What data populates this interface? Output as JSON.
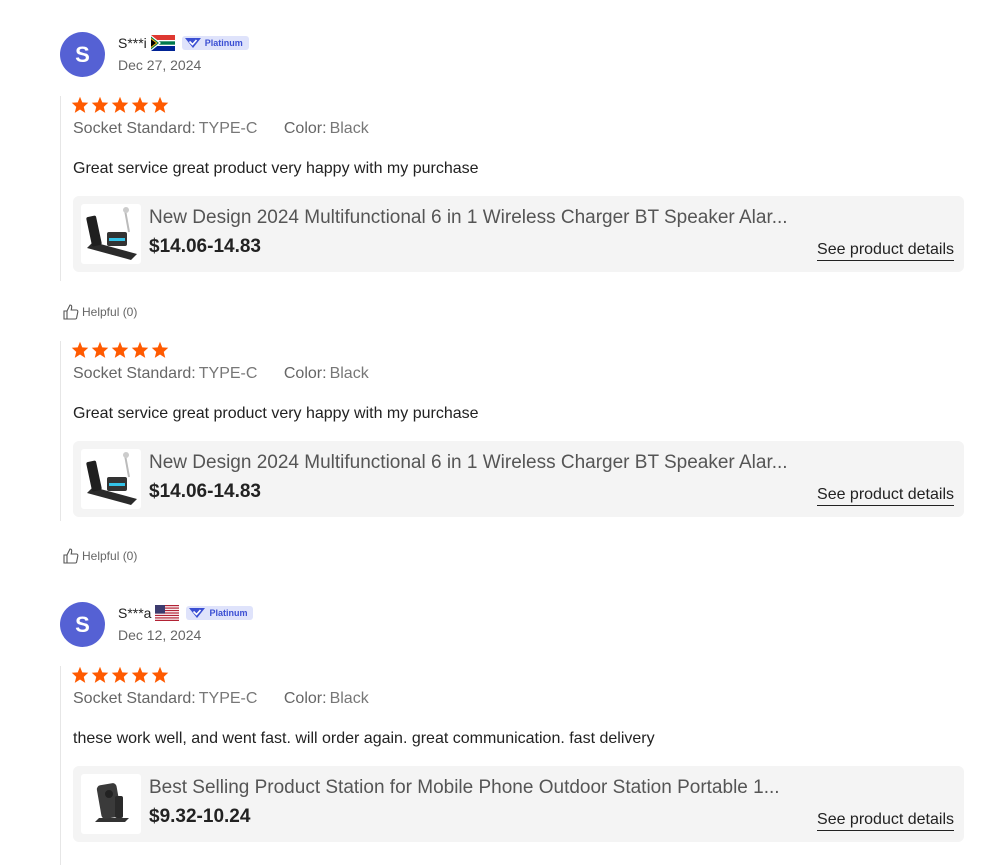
{
  "colors": {
    "avatar": "#5561d4",
    "star": "#ff5a00",
    "badge_bg": "#dfe3fb",
    "badge_text": "#3b4fd3",
    "card_bg": "#f4f4f4"
  },
  "reviews": [
    {
      "reviewer": {
        "initial": "S",
        "name": "S***i",
        "flag": "south-africa-flag-icon",
        "badge": "Platinum",
        "date": "Dec 27, 2024"
      },
      "rating": 5,
      "specs": [
        {
          "label": "Socket Standard:",
          "value": "TYPE-C"
        },
        {
          "label": "Color:",
          "value": "Black"
        }
      ],
      "comment": "Great service great product very happy with my purchase",
      "product": {
        "thumb_icon": "wireless-charger-stand-icon",
        "title": "New Design 2024 Multifunctional 6 in 1 Wireless Charger BT Speaker Alar...",
        "price": "$14.06-14.83",
        "details_link": "See product details"
      },
      "helpful": "Helpful (0)"
    },
    {
      "reviewer": null,
      "rating": 5,
      "specs": [
        {
          "label": "Socket Standard:",
          "value": "TYPE-C"
        },
        {
          "label": "Color:",
          "value": "Black"
        }
      ],
      "comment": "Great service great product very happy with my purchase",
      "product": {
        "thumb_icon": "wireless-charger-stand-icon",
        "title": "New Design 2024 Multifunctional 6 in 1 Wireless Charger BT Speaker Alar...",
        "price": "$14.06-14.83",
        "details_link": "See product details"
      },
      "helpful": "Helpful (0)"
    },
    {
      "reviewer": {
        "initial": "S",
        "name": "S***a",
        "flag": "usa-flag-icon",
        "badge": "Platinum",
        "date": "Dec 12, 2024"
      },
      "rating": 5,
      "specs": [
        {
          "label": "Socket Standard:",
          "value": "TYPE-C"
        },
        {
          "label": "Color:",
          "value": "Black"
        }
      ],
      "comment": "these work well, and went fast. will order again. great communication. fast delivery",
      "product": {
        "thumb_icon": "phone-charging-station-icon",
        "title": "Best Selling Product Station for Mobile Phone Outdoor Station Portable 1...",
        "price": "$9.32-10.24",
        "details_link": "See product details"
      },
      "helpful": null
    }
  ]
}
